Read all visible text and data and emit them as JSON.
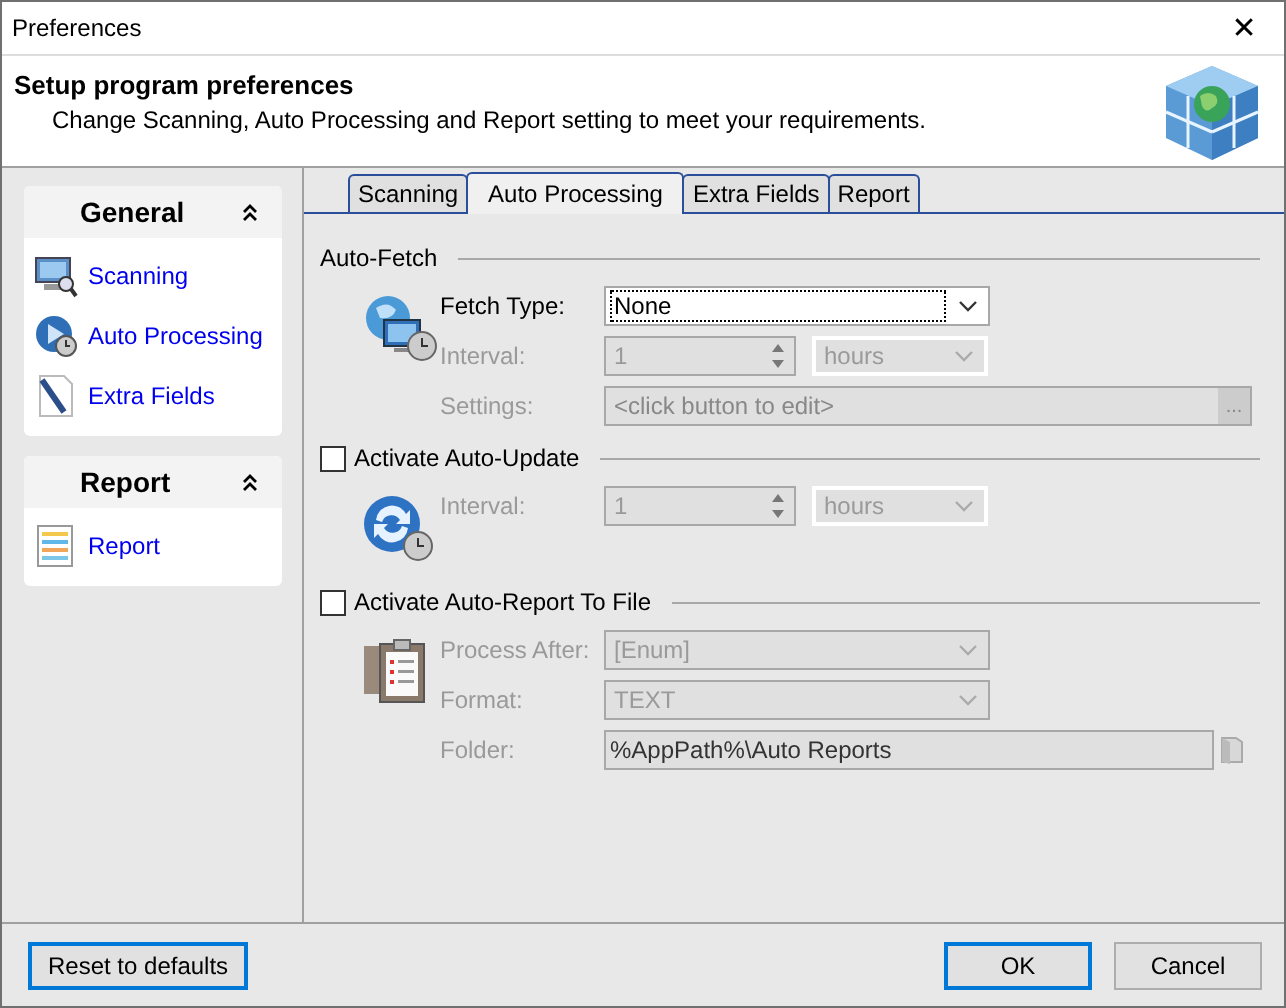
{
  "window": {
    "title": "Preferences",
    "close": "✕"
  },
  "header": {
    "title": "Setup program preferences",
    "subtitle": "Change Scanning, Auto Processing and Report setting to meet your requirements."
  },
  "sidebar": {
    "groups": [
      {
        "title": "General",
        "expanded": true,
        "items": [
          {
            "label": "Scanning"
          },
          {
            "label": "Auto Processing"
          },
          {
            "label": "Extra Fields"
          }
        ]
      },
      {
        "title": "Report",
        "expanded": true,
        "items": [
          {
            "label": "Report"
          }
        ]
      }
    ]
  },
  "tabs": [
    {
      "label": "Scanning",
      "selected": false
    },
    {
      "label": "Auto Processing",
      "selected": true
    },
    {
      "label": "Extra Fields",
      "selected": false
    },
    {
      "label": "Report",
      "selected": false
    }
  ],
  "sections": [
    {
      "title": "Auto-Fetch",
      "kind": "plain",
      "fields": [
        {
          "label": "Fetch Type:",
          "kind": "combo",
          "value": "None",
          "disabled": false,
          "focused": true
        },
        {
          "label": "Interval:",
          "kind": "spin",
          "value": "1",
          "unit": "hours",
          "disabled": true
        },
        {
          "label": "Settings:",
          "kind": "browse",
          "value": "<click button to edit>",
          "button": "...",
          "disabled": true
        }
      ]
    },
    {
      "title": "Activate Auto-Update",
      "kind": "checkbox",
      "checked": false,
      "fields": [
        {
          "label": "Interval:",
          "kind": "spin",
          "value": "1",
          "unit": "hours",
          "disabled": true
        }
      ]
    },
    {
      "title": "Activate Auto-Report To File",
      "kind": "checkbox",
      "checked": false,
      "fields": [
        {
          "label": "Process After:",
          "kind": "combo",
          "value": "[Enum]",
          "disabled": true,
          "focused": false
        },
        {
          "label": "Format:",
          "kind": "combo",
          "value": "TEXT",
          "disabled": true,
          "focused": false
        },
        {
          "label": "Folder:",
          "kind": "path",
          "value": "%AppPath%\\Auto Reports",
          "disabled": true
        }
      ]
    }
  ],
  "buttons": [
    {
      "label": "Reset to defaults",
      "focused": true,
      "kind": "left"
    },
    {
      "label": "OK",
      "focused": true,
      "kind": "right"
    },
    {
      "label": "Cancel",
      "focused": false,
      "kind": "right"
    }
  ]
}
